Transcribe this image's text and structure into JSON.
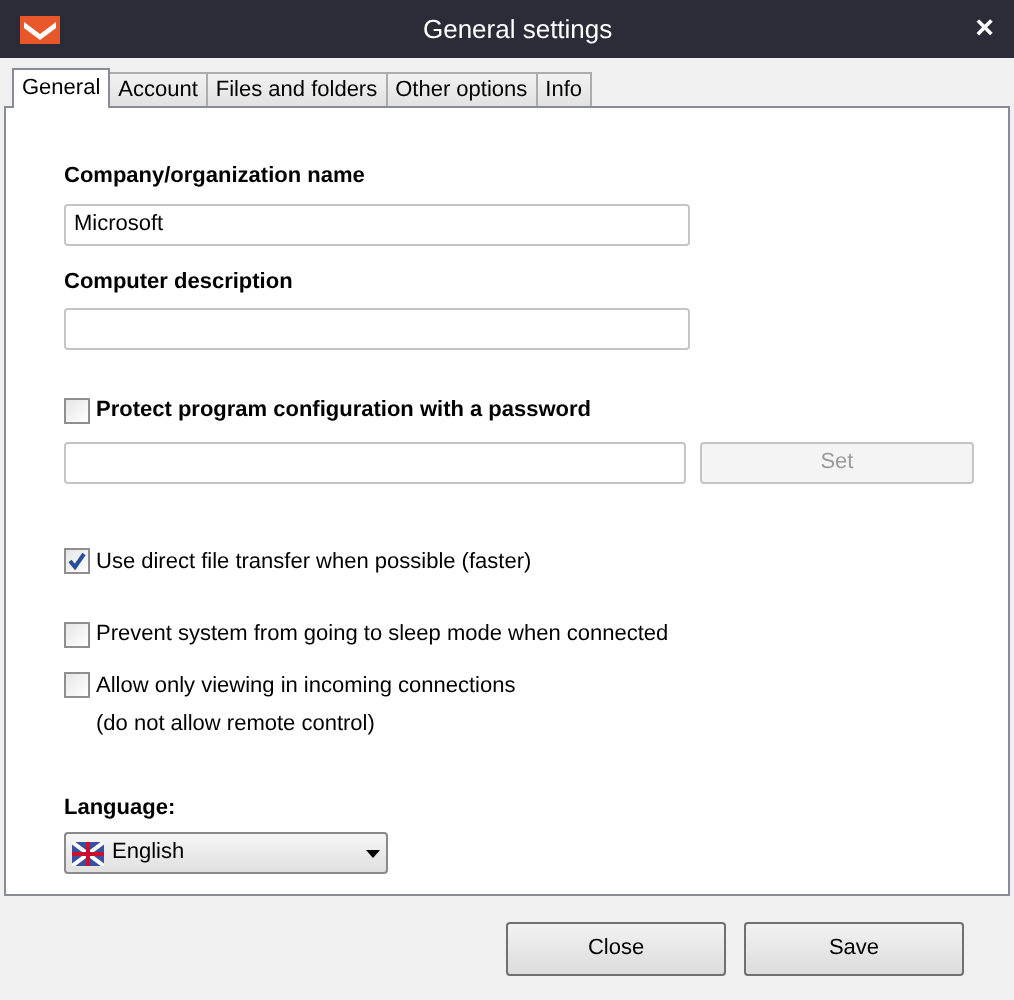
{
  "window": {
    "title": "General settings",
    "close": "×"
  },
  "tabs": [
    {
      "label": "General",
      "selected": true
    },
    {
      "label": "Account",
      "selected": false
    },
    {
      "label": "Files and folders",
      "selected": false
    },
    {
      "label": "Other options",
      "selected": false
    },
    {
      "label": "Info",
      "selected": false
    }
  ],
  "fields": [
    {
      "label": "Company/organization name",
      "value": "Microsoft"
    },
    {
      "label": "Computer description"
    }
  ],
  "password": {
    "label": "Protect program configuration with a password",
    "checked": false,
    "button": "Set",
    "button_disabled": true
  },
  "options": [
    {
      "label": "Use direct file transfer when possible (faster)",
      "checked": true
    },
    {
      "label": "Prevent system from going to sleep mode when connected",
      "checked": false
    },
    {
      "label": "Allow only viewing in incoming connections",
      "note": "(do not allow remote control)",
      "checked": false
    }
  ],
  "language": {
    "label": "Language:",
    "value": "English"
  },
  "buttons": [
    "Close",
    "Save"
  ]
}
